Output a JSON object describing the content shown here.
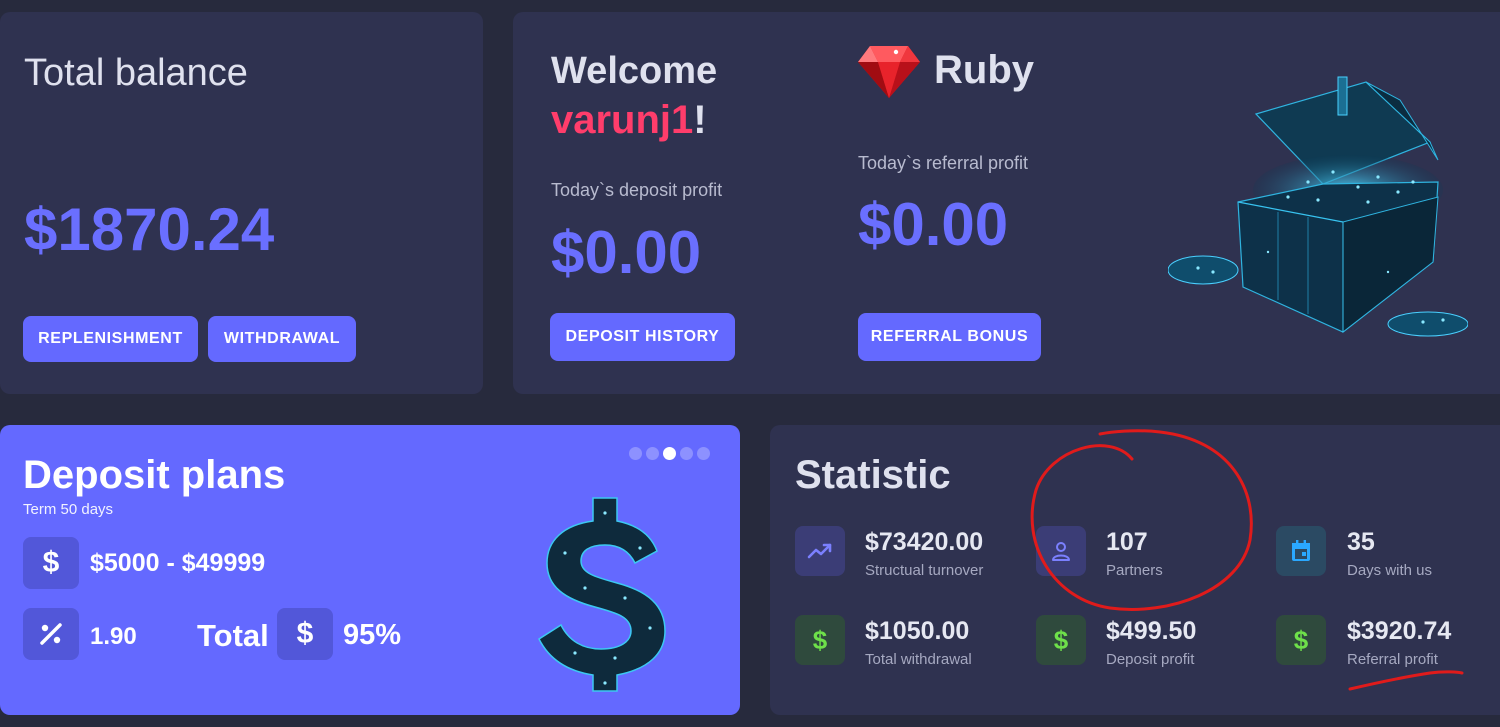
{
  "total_balance": {
    "title": "Total balance",
    "amount": "$1870.24",
    "replenish_label": "REPLENISHMENT",
    "withdraw_label": "WITHDRAWAL"
  },
  "welcome": {
    "greeting": "Welcome",
    "username": "varunj1",
    "exclaim": "!",
    "deposit_label": "Today`s deposit profit",
    "deposit_amount": "$0.00",
    "deposit_history_label": "DEPOSIT HISTORY",
    "rank": "Ruby",
    "referral_label": "Today`s referral profit",
    "referral_amount": "$0.00",
    "referral_bonus_label": "REFERRAL BONUS"
  },
  "deposit_plans": {
    "title": "Deposit plans",
    "term": "Term 50 days",
    "range": "$5000 - $49999",
    "percent": "1.90",
    "total_label": "Total",
    "total_value": "95%",
    "slides": 5,
    "active_slide": 3
  },
  "statistic": {
    "title": "Statistic",
    "items": [
      {
        "value": "$73420.00",
        "label": "Structual turnover",
        "icon": "trending-up-icon"
      },
      {
        "value": "107",
        "label": "Partners",
        "icon": "person-icon"
      },
      {
        "value": "35",
        "label": "Days with us",
        "icon": "calendar-icon"
      },
      {
        "value": "$1050.00",
        "label": "Total withdrawal",
        "icon": "dollar-icon"
      },
      {
        "value": "$499.50",
        "label": "Deposit profit",
        "icon": "dollar-icon"
      },
      {
        "value": "$3920.74",
        "label": "Referral profit",
        "icon": "dollar-icon"
      }
    ]
  },
  "colors": {
    "background": "#272a3d",
    "card": "#2f3250",
    "accent": "#6469ff",
    "username": "#ff3d6b",
    "money_green": "#6ee04a",
    "annotation_red": "#e01b1b"
  }
}
